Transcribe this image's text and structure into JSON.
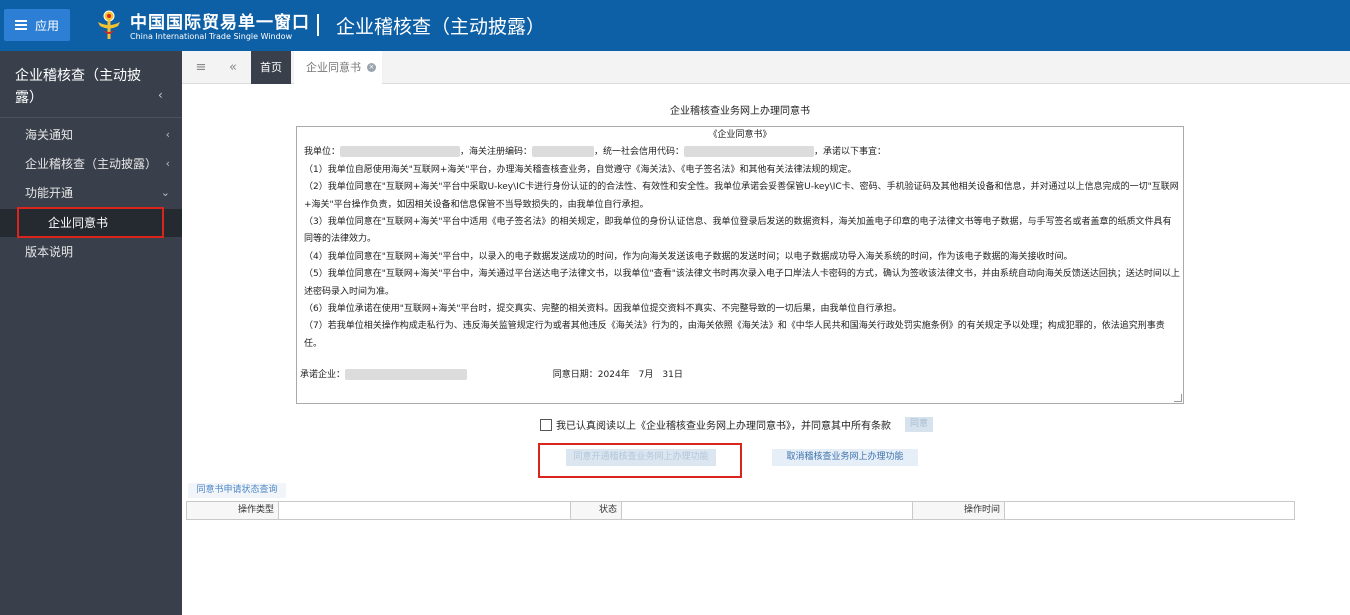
{
  "header": {
    "app_button_label": "应用",
    "brand_cn": "中国国际贸易单一窗口",
    "brand_en": "China International Trade Single Window",
    "page_title": "企业稽核查（主动披露）"
  },
  "sidebar": {
    "title": "企业稽核查（主动披露）",
    "items": [
      {
        "label": "海关通知",
        "arrow": "‹"
      },
      {
        "label": "企业稽核查（主动披露）",
        "arrow": "‹"
      },
      {
        "label": "功能开通",
        "arrow": "⌄"
      },
      {
        "label": "企业同意书"
      },
      {
        "label": "版本说明"
      }
    ]
  },
  "tabs": {
    "home": "首页",
    "active": "企业同意书"
  },
  "document": {
    "heading": "企业稽核查业务网上办理同意书",
    "box_title": "《企业同意书》",
    "intro_1": "我单位：",
    "intro_2": "，海关注册编码：",
    "intro_3": "，统一社会信用代码：",
    "intro_4": "，承诺以下事宜：",
    "clauses": [
      "（1）我单位自愿使用海关\"互联网+海关\"平台，办理海关稽查核查业务，自觉遵守《海关法》、《电子签名法》和其他有关法律法规的规定。",
      "（2）我单位同意在\"互联网+海关\"平台中采取U-key\\IC卡进行身份认证的的合法性、有效性和安全性。我单位承诺会妥善保管U-key\\IC卡、密码、手机验证码及其他相关设备和信息，并对通过以上信息完成的一切\"互联网+海关\"平台操作负责，如因相关设备和信息保管不当导致损失的，由我单位自行承担。",
      "（3）我单位同意在\"互联网+海关\"平台中适用《电子签名法》的相关规定，即我单位的身份认证信息、我单位登录后发送的数据资料，海关加盖电子印章的电子法律文书等电子数据，与手写签名或者盖章的纸质文件具有同等的法律效力。",
      "（4）我单位同意在\"互联网+海关\"平台中，以录入的电子数据发送成功的时间，作为向海关发送该电子数据的发送时间；以电子数据成功导入海关系统的时间，作为该电子数据的海关接收时间。",
      "（5）我单位同意在\"互联网+海关\"平台中，海关通过平台送达电子法律文书，以我单位\"查看\"该法律文书时再次录入电子口岸法人卡密码的方式，确认为签收该法律文书，并由系统自动向海关反馈送达回执；送达时间以上述密码录入时间为准。",
      "（6）我单位承诺在使用\"互联网+海关\"平台时，提交真实、完整的相关资料。因我单位提交资料不真实、不完整导致的一切后果，由我单位自行承担。",
      "（7）若我单位相关操作构成走私行为、违反海关监管规定行为或者其他违反《海关法》行为的，由海关依照《海关法》和《中华人民共和国海关行政处罚实施条例》的有关规定予以处理；构成犯罪的，依法追究刑事责任。"
    ],
    "signer_label": "承诺企业：",
    "date_label": "同意日期：",
    "date_value": "2024年　7月　31日"
  },
  "agree": {
    "label": "我已认真阅读以上《企业稽核查业务网上办理同意书》，并同意其中所有条款",
    "button": "同意"
  },
  "actions": {
    "open_button": "同意开通稽核查业务网上办理功能",
    "cancel_button": "取消稽核查业务网上办理功能"
  },
  "status": {
    "tab_label": "同意书申请状态查询",
    "columns": [
      "操作类型",
      "状态",
      "操作时间"
    ]
  }
}
